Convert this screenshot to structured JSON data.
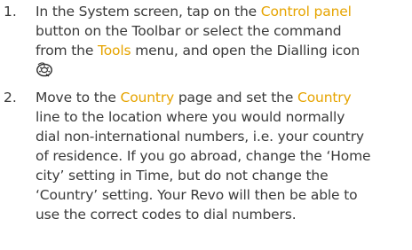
{
  "colors": {
    "text": "#3a3a3a",
    "highlight": "#e6a400",
    "background": "#ffffff"
  },
  "steps": [
    {
      "number": "1.",
      "icon": "dialling-icon",
      "lines": [
        [
          "In the System screen, tap on the ",
          "Control panel",
          ""
        ],
        [
          "button on the Toolbar or select the command",
          "",
          ""
        ],
        [
          "from the ",
          "Tools",
          " menu, and open the Dialling icon"
        ]
      ]
    },
    {
      "number": "2.",
      "lines": [
        [
          "Move to the ",
          "Country",
          " page and set the ",
          "Country"
        ],
        [
          "line to the location where you would normally"
        ],
        [
          "dial non-international numbers, i.e. your country"
        ],
        [
          "of residence. If you go abroad, change the ‘Home"
        ],
        [
          "city’ setting in Time, but do not change the"
        ],
        [
          "‘Country’ setting. Your Revo will then be able to"
        ],
        [
          "use the correct codes to dial numbers."
        ]
      ]
    }
  ]
}
